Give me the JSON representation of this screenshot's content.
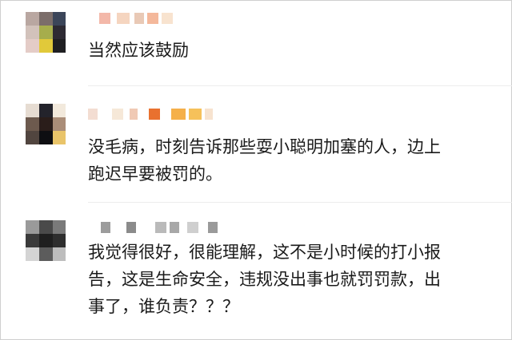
{
  "comments": [
    {
      "username": "",
      "avatar_colors": [
        "#b9a7a1",
        "#7b6d6a",
        "#3b4559",
        "#d2c2bb",
        "#a6ad4c",
        "#2d2a33",
        "#e4ccc7",
        "#e1c93a",
        "#1f1f22"
      ],
      "username_colors": [
        "#f3b8a9",
        "#f5d5c0",
        "#e9c9b6",
        "#f4b89b",
        "#f8e3cf"
      ],
      "text": "当然应该鼓励"
    },
    {
      "username": "",
      "avatar_colors": [
        "#e6dcd2",
        "#23232b",
        "#f2e9dc",
        "#6d5a4e",
        "#2a1d1a",
        "#aa8d78",
        "#51453f",
        "#0e0e12",
        "#e9c46a"
      ],
      "username_colors": [
        "#f3ddd2",
        "#f6e8d8",
        "#f0c9b4",
        "#e9712f",
        "#f5b04a",
        "#f6c15a",
        "#f7e3cf"
      ],
      "text": "没毛病，时刻告诉那些耍小聪明加塞的人，边上\n跑迟早要被罚的。"
    },
    {
      "username": "",
      "avatar_colors": [
        "#9a9a9a",
        "#4a4a4a",
        "#7a7a7a",
        "#3a3a3a",
        "#1f1f1f",
        "#2e2e2e",
        "#d4d4d4",
        "#5c5c5c",
        "#bdbdbd"
      ],
      "username_colors": [
        "#9c9c9c",
        "#8b8b8b",
        "#bababa",
        "#a8a8a8",
        "#cfcfcf",
        "#9a9a9a"
      ],
      "text": "我觉得很好，很能理解，这不是小时候的打小报\n告，这是生命安全，违规没出事也就罚罚款，出\n事了，谁负责？？？"
    }
  ]
}
